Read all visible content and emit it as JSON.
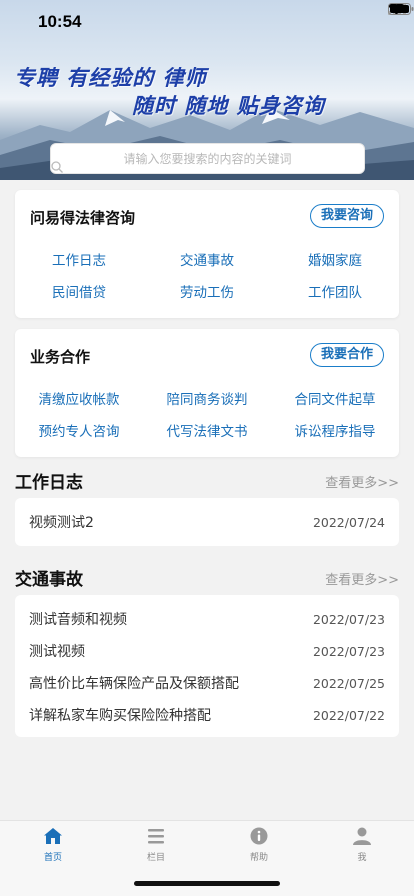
{
  "status": {
    "time": "10:54"
  },
  "hero": {
    "slogan_line1": "专聘 有经验的 律师",
    "slogan_line2": "随时 随地 贴身咨询",
    "search_placeholder": "请输入您要搜索的内容的关键词"
  },
  "consult_card": {
    "title": "问易得法律咨询",
    "button": "我要咨询",
    "links": [
      "工作日志",
      "交通事故",
      "婚姻家庭",
      "民间借贷",
      "劳动工伤",
      "工作团队"
    ]
  },
  "business_card": {
    "title": "业务合作",
    "button": "我要合作",
    "links": [
      "清缴应收帐款",
      "陪同商务谈判",
      "合同文件起草",
      "预约专人咨询",
      "代写法律文书",
      "诉讼程序指导"
    ]
  },
  "worklog": {
    "title": "工作日志",
    "more": "查看更多>>",
    "items": [
      {
        "title": "视频测试2",
        "date": "2022/07/24"
      }
    ]
  },
  "traffic": {
    "title": "交通事故",
    "more": "查看更多>>",
    "items": [
      {
        "title": "测试音频和视频",
        "date": "2022/07/23"
      },
      {
        "title": "测试视频",
        "date": "2022/07/23"
      },
      {
        "title": "高性价比车辆保险产品及保额搭配",
        "date": "2022/07/25"
      },
      {
        "title": "详解私家车购买保险险种搭配",
        "date": "2022/07/22"
      }
    ]
  },
  "tabs": [
    {
      "label": "首页",
      "icon": "home-icon",
      "active": true
    },
    {
      "label": "栏目",
      "icon": "menu-icon",
      "active": false
    },
    {
      "label": "帮助",
      "icon": "info-icon",
      "active": false
    },
    {
      "label": "我",
      "icon": "user-icon",
      "active": false
    }
  ],
  "colors": {
    "accent": "#1a6fb8",
    "slogan": "#1d3fa8"
  }
}
